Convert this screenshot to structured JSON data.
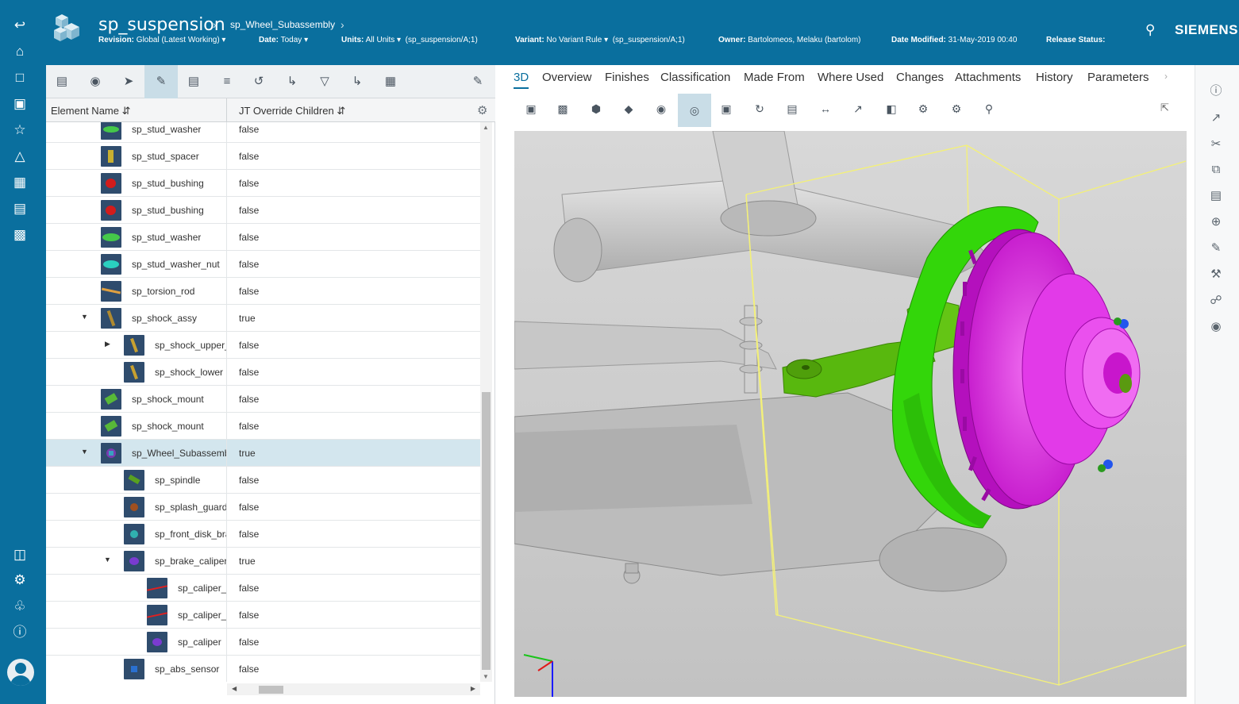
{
  "header": {
    "title": "sp_suspension",
    "crumb": "sp_Wheel_Subassembly",
    "revision_label": "Revision:",
    "revision_value": "Global (Latest Working)",
    "date_label": "Date:",
    "date_value": "Today",
    "units_label": "Units:",
    "units_value": "All Units",
    "units_context": "(sp_suspension/A;1)",
    "variant_label": "Variant:",
    "variant_value": "No Variant Rule",
    "variant_context": "(sp_suspension/A;1)",
    "owner_label": "Owner:",
    "owner_value": "Bartolomeos, Melaku (bartolom)",
    "modified_label": "Date Modified:",
    "modified_value": "31-May-2019 00:40",
    "release_label": "Release Status:",
    "brand": "SIEMENS"
  },
  "table": {
    "col_name": "Element Name",
    "col_override": "JT Override Children",
    "rows": [
      {
        "name": "sp_stud_washer",
        "value": "false"
      },
      {
        "name": "sp_stud_spacer",
        "value": "false"
      },
      {
        "name": "sp_stud_bushing",
        "value": "false"
      },
      {
        "name": "sp_stud_bushing",
        "value": "false"
      },
      {
        "name": "sp_stud_washer",
        "value": "false"
      },
      {
        "name": "sp_stud_washer_nut",
        "value": "false"
      },
      {
        "name": "sp_torsion_rod",
        "value": "false"
      },
      {
        "name": "sp_shock_assy",
        "value": "true"
      },
      {
        "name": "sp_shock_upper_",
        "value": "false"
      },
      {
        "name": "sp_shock_lower",
        "value": "false"
      },
      {
        "name": "sp_shock_mount",
        "value": "false"
      },
      {
        "name": "sp_shock_mount",
        "value": "false"
      },
      {
        "name": "sp_Wheel_Subassemb",
        "value": "true"
      },
      {
        "name": "sp_spindle",
        "value": "false"
      },
      {
        "name": "sp_splash_guard",
        "value": "false"
      },
      {
        "name": "sp_front_disk_bra",
        "value": "false"
      },
      {
        "name": "sp_brake_caliper",
        "value": "true"
      },
      {
        "name": "sp_caliper_",
        "value": "false"
      },
      {
        "name": "sp_caliper_",
        "value": "false"
      },
      {
        "name": "sp_caliper",
        "value": "false"
      },
      {
        "name": "sp_abs_sensor",
        "value": "false"
      }
    ]
  },
  "tabs": [
    "3D",
    "Overview",
    "Finishes",
    "Classification",
    "Made From",
    "Where Used",
    "Changes",
    "Attachments",
    "History",
    "Parameters"
  ],
  "colors": {
    "brand": "#0a6f9e",
    "rotor": "#e020e0",
    "guard": "#33d60a",
    "spindle": "#58b80e",
    "bounding_box": "#f3f07a"
  }
}
